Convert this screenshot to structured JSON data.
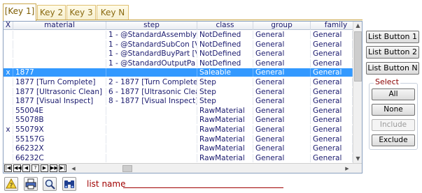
{
  "tabs": [
    {
      "label": "[Key 1]",
      "active": true
    },
    {
      "label": "Key 2",
      "active": false
    },
    {
      "label": "Key 3",
      "active": false
    },
    {
      "label": "Key N",
      "active": false
    }
  ],
  "grid": {
    "columns": [
      "X",
      "material",
      "step",
      "class",
      "group",
      "family"
    ],
    "rows": [
      {
        "x": "",
        "material": "",
        "step": "1 - @StandardAssembly",
        "class": "NotDefined",
        "group": "General",
        "family": "General",
        "selected": false
      },
      {
        "x": "",
        "material": "",
        "step": "1 - @StandardSubCon [V",
        "class": "NotDefined",
        "group": "General",
        "family": "General",
        "selected": false
      },
      {
        "x": "",
        "material": "",
        "step": "1 - @StandardBuyPart [V",
        "class": "NotDefined",
        "group": "General",
        "family": "General",
        "selected": false
      },
      {
        "x": "",
        "material": "",
        "step": "1 - @StandardOutputPa",
        "class": "NotDefined",
        "group": "General",
        "family": "General",
        "selected": false
      },
      {
        "x": "x",
        "material": "1877",
        "step": "",
        "class": "Saleable",
        "group": "General",
        "family": "General",
        "selected": true
      },
      {
        "x": "",
        "material": "1877 [Turn Complete]",
        "step": "2 - 1877 [Turn Complete]",
        "class": "Step",
        "group": "General",
        "family": "General",
        "selected": false
      },
      {
        "x": "",
        "material": "1877 [Ultrasonic Clean]",
        "step": "6 - 1877 [Ultrasonic Clea",
        "class": "Step",
        "group": "General",
        "family": "General",
        "selected": false
      },
      {
        "x": "",
        "material": "1877 [Visual Inspect]",
        "step": "8 - 1877 [Visual Inspect]",
        "class": "Step",
        "group": "General",
        "family": "General",
        "selected": false
      },
      {
        "x": "",
        "material": "55004E",
        "step": "",
        "class": "RawMaterial",
        "group": "General",
        "family": "General",
        "selected": false
      },
      {
        "x": "",
        "material": "55078B",
        "step": "",
        "class": "RawMaterial",
        "group": "General",
        "family": "General",
        "selected": false
      },
      {
        "x": "x",
        "material": "55079X",
        "step": "",
        "class": "RawMaterial",
        "group": "General",
        "family": "General",
        "selected": false
      },
      {
        "x": "",
        "material": "55157G",
        "step": "",
        "class": "RawMaterial",
        "group": "General",
        "family": "General",
        "selected": false
      },
      {
        "x": "",
        "material": "66232X",
        "step": "",
        "class": "RawMaterial",
        "group": "General",
        "family": "General",
        "selected": false
      },
      {
        "x": "",
        "material": "66232C",
        "step": "",
        "class": "RawMaterial",
        "group": "General",
        "family": "General",
        "selected": false
      }
    ],
    "nav_buttons": [
      "first",
      "prev-page",
      "prev",
      "help",
      "next",
      "next-page",
      "last"
    ]
  },
  "list_buttons": [
    "List Button 1",
    "List Button 2",
    "List Button N"
  ],
  "select": {
    "title": "Select",
    "buttons": [
      {
        "label": "All",
        "disabled": false
      },
      {
        "label": "None",
        "disabled": false
      },
      {
        "label": "Include",
        "disabled": true
      },
      {
        "label": "Exclude",
        "disabled": false
      }
    ]
  },
  "toolbar": {
    "icons": [
      "help-icon",
      "print-icon",
      "search-icon",
      "binoculars-icon"
    ],
    "list_name_label": "list name"
  },
  "colors": {
    "selection": "#3399ff",
    "label_red": "#a00000",
    "tab_gold": "#c9a64a"
  }
}
